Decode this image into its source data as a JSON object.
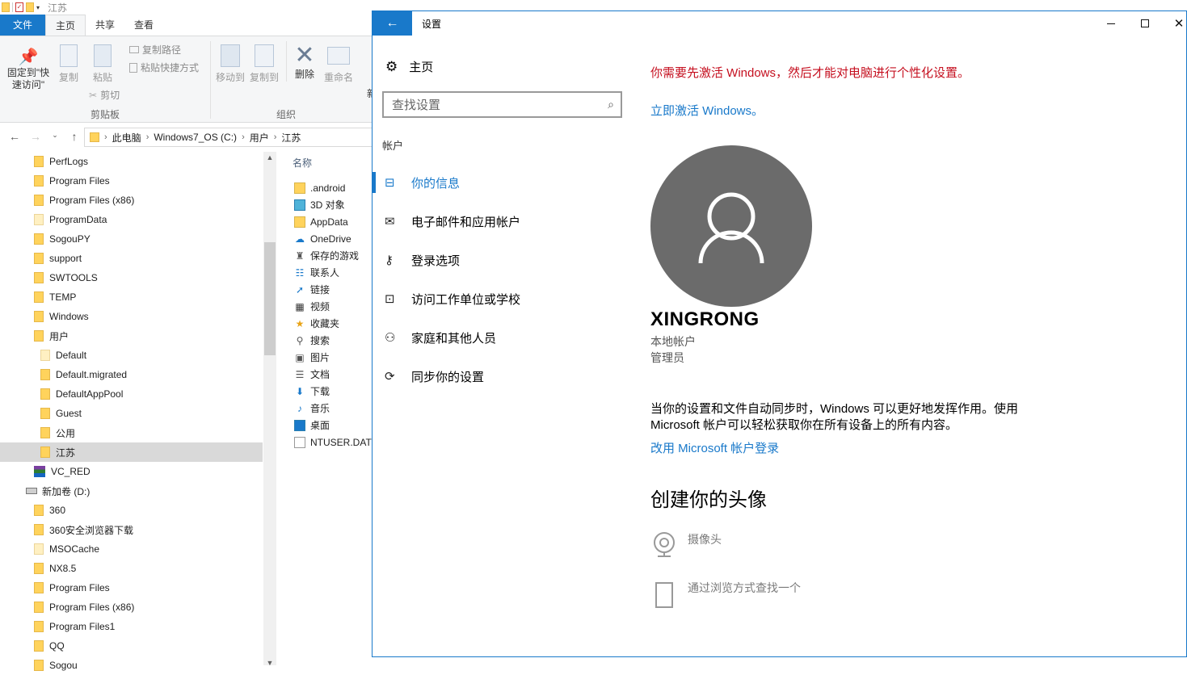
{
  "explorer": {
    "window_title": "江苏",
    "ribbon_tabs": [
      "文件",
      "主页",
      "共享",
      "查看"
    ],
    "ribbon": {
      "pin_label_1": "固定到\"快",
      "pin_label_2": "速访问\"",
      "copy": "复制",
      "paste": "粘贴",
      "copy_path": "复制路径",
      "paste_shortcut": "粘贴快捷方式",
      "cut": "剪切",
      "clipboard_group": "剪贴板",
      "move_to": "移动到",
      "copy_to": "复制到",
      "delete": "删除",
      "rename": "重命名",
      "organize_group": "组织",
      "new_cut": "新"
    },
    "breadcrumb": [
      "此电脑",
      "Windows7_OS (C:)",
      "用户",
      "江苏"
    ],
    "tree": [
      {
        "label": "PerfLogs",
        "indent": 1
      },
      {
        "label": "Program Files",
        "indent": 1
      },
      {
        "label": "Program Files (x86)",
        "indent": 1
      },
      {
        "label": "ProgramData",
        "indent": 1,
        "pale": true
      },
      {
        "label": "SogouPY",
        "indent": 1
      },
      {
        "label": "support",
        "indent": 1
      },
      {
        "label": "SWTOOLS",
        "indent": 1
      },
      {
        "label": "TEMP",
        "indent": 1
      },
      {
        "label": "Windows",
        "indent": 1
      },
      {
        "label": "用户",
        "indent": 1
      },
      {
        "label": "Default",
        "indent": 2,
        "pale": true
      },
      {
        "label": "Default.migrated",
        "indent": 2
      },
      {
        "label": "DefaultAppPool",
        "indent": 2
      },
      {
        "label": "Guest",
        "indent": 2
      },
      {
        "label": "公用",
        "indent": 2
      },
      {
        "label": "江苏",
        "indent": 2,
        "selected": true
      },
      {
        "label": "VC_RED",
        "indent": 1,
        "icon": "rar-icon"
      },
      {
        "label": "新加卷 (D:)",
        "indent": 0,
        "icon": "drive-icon"
      },
      {
        "label": "360",
        "indent": 1
      },
      {
        "label": "360安全浏览器下载",
        "indent": 1
      },
      {
        "label": "MSOCache",
        "indent": 1,
        "pale": true
      },
      {
        "label": "NX8.5",
        "indent": 1
      },
      {
        "label": "Program Files",
        "indent": 1
      },
      {
        "label": "Program Files (x86)",
        "indent": 1
      },
      {
        "label": "Program Files1",
        "indent": 1
      },
      {
        "label": "QQ",
        "indent": 1
      },
      {
        "label": "Sogou",
        "indent": 1
      }
    ],
    "file_header": "名称",
    "files": [
      {
        "label": ".android",
        "icon": "folder-icon"
      },
      {
        "label": "3D 对象",
        "icon": "3d-objects-icon"
      },
      {
        "label": "AppData",
        "icon": "folder-icon"
      },
      {
        "label": "OneDrive",
        "icon": "onedrive-icon"
      },
      {
        "label": "保存的游戏",
        "icon": "saved-games-icon"
      },
      {
        "label": "联系人",
        "icon": "contacts-icon"
      },
      {
        "label": "链接",
        "icon": "links-icon"
      },
      {
        "label": "视频",
        "icon": "videos-icon"
      },
      {
        "label": "收藏夹",
        "icon": "favorites-icon"
      },
      {
        "label": "搜索",
        "icon": "searches-icon"
      },
      {
        "label": "图片",
        "icon": "pictures-icon"
      },
      {
        "label": "文档",
        "icon": "documents-icon"
      },
      {
        "label": "下载",
        "icon": "downloads-icon"
      },
      {
        "label": "音乐",
        "icon": "music-icon"
      },
      {
        "label": "桌面",
        "icon": "desktop-icon"
      },
      {
        "label": "NTUSER.DAT",
        "icon": "file-icon"
      }
    ]
  },
  "settings": {
    "window_title": "设置",
    "home": "主页",
    "search_placeholder": "查找设置",
    "section": "帐户",
    "nav": [
      {
        "label": "你的信息",
        "icon": "person-card-icon",
        "active": true
      },
      {
        "label": "电子邮件和应用帐户",
        "icon": "mail-icon"
      },
      {
        "label": "登录选项",
        "icon": "key-icon"
      },
      {
        "label": "访问工作单位或学校",
        "icon": "briefcase-icon"
      },
      {
        "label": "家庭和其他人员",
        "icon": "person-add-icon"
      },
      {
        "label": "同步你的设置",
        "icon": "sync-icon"
      }
    ],
    "warning": "你需要先激活 Windows，然后才能对电脑进行个性化设置。",
    "activate_link": "立即激活 Windows。",
    "user_name": "XINGRONG",
    "account_type": "本地帐户",
    "role": "管理员",
    "sync_paragraph": "当你的设置和文件自动同步时，Windows 可以更好地发挥作用。使用 Microsoft 帐户可以轻松获取你在所有设备上的所有内容。",
    "ms_login_link": "改用 Microsoft 帐户登录",
    "create_avatar_heading": "创建你的头像",
    "avatar_options": [
      {
        "label": "摄像头",
        "icon": "camera-icon"
      },
      {
        "label": "通过浏览方式查找一个",
        "icon": "browse-icon"
      }
    ],
    "colors": {
      "accent": "#1979ca",
      "warning": "#c50f1f",
      "avatar_bg": "#6b6b6b"
    }
  }
}
